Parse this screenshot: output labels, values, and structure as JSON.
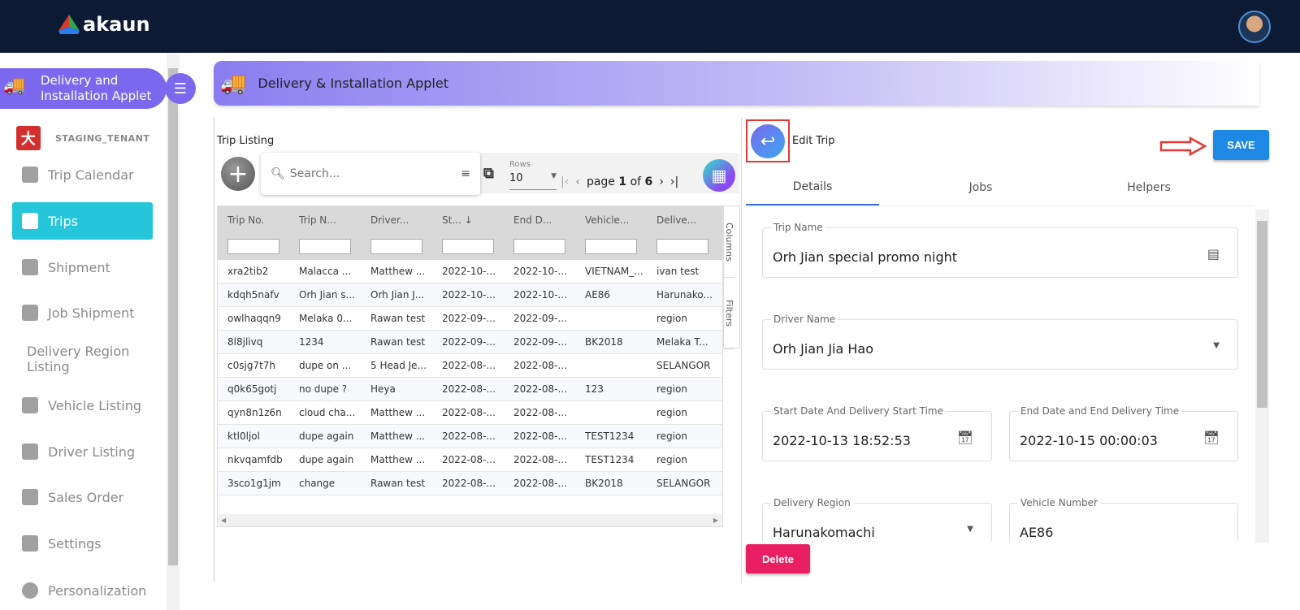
{
  "header": {
    "brand": "akaun"
  },
  "sidebar": {
    "applet_title": "Delivery and Installation Applet",
    "tenant": "STAGING_TENANT",
    "items": [
      {
        "label": "Trip Calendar",
        "icon": "calendar-icon"
      },
      {
        "label": "Trips",
        "icon": "map-icon",
        "active": true
      },
      {
        "label": "Shipment",
        "icon": "ship-icon"
      },
      {
        "label": "Job Shipment",
        "icon": "ship-icon"
      },
      {
        "label": "Delivery Region Listing",
        "icon": ""
      },
      {
        "label": "Vehicle Listing",
        "icon": "truck-icon"
      },
      {
        "label": "Driver Listing",
        "icon": "badge-icon"
      },
      {
        "label": "Sales Order",
        "icon": "ship-icon"
      },
      {
        "label": "Settings",
        "icon": "gear-icon"
      },
      {
        "label": "Personalization",
        "icon": "avatar"
      }
    ]
  },
  "banner": {
    "title": "Delivery & Installation Applet"
  },
  "listing": {
    "title": "Trip Listing",
    "search_placeholder": "Search...",
    "rows_label": "Rows",
    "rows_value": "10",
    "page_prefix": "page",
    "page": "1",
    "of": "of",
    "total_pages": "6",
    "side_tabs": [
      "Columns",
      "Filters"
    ],
    "columns": [
      "Trip No.",
      "Trip N...",
      "Driver...",
      "St...  ↓",
      "End D...",
      "Vehicle...",
      "Delive..."
    ],
    "rows": [
      [
        "xra2tib2",
        "Malacca ...",
        "Matthew ...",
        "2022-10-...",
        "2022-10-...",
        "VIETNAM_...",
        "ivan test"
      ],
      [
        "kdqh5nafv",
        "Orh Jian s...",
        "Orh Jian J...",
        "2022-10-...",
        "2022-10-...",
        "AE86",
        "Harunako..."
      ],
      [
        "owlhaqqn9",
        "Melaka 0...",
        "Rawan test",
        "2022-09-...",
        "2022-09-...",
        "",
        "region"
      ],
      [
        "8l8jlivq",
        "1234",
        "Rawan test",
        "2022-09-...",
        "2022-09-...",
        "BK2018",
        "Melaka T..."
      ],
      [
        "c0sjg7t7h",
        "dupe on ...",
        "5 Head Je...",
        "2022-08-...",
        "2022-08-...",
        "",
        "SELANGOR"
      ],
      [
        "q0k65gotj",
        "no dupe ?",
        "Heya",
        "2022-08-...",
        "2022-08-...",
        "123",
        "region"
      ],
      [
        "qyn8n1z6n",
        "cloud cha...",
        "Matthew ...",
        "2022-08-...",
        "2022-08-...",
        "",
        "region"
      ],
      [
        "ktl0ljol",
        "dupe again",
        "Matthew ...",
        "2022-08-...",
        "2022-08-...",
        "TEST1234",
        "region"
      ],
      [
        "nkvqamfdb",
        "dupe again",
        "Matthew ...",
        "2022-08-...",
        "2022-08-...",
        "TEST1234",
        "region"
      ],
      [
        "3sco1g1jm",
        "change",
        "Rawan test",
        "2022-08-...",
        "2022-08-...",
        "BK2018",
        "SELANGOR"
      ]
    ]
  },
  "edit": {
    "title": "Edit Trip",
    "save_label": "SAVE",
    "delete_label": "Delete",
    "tabs": [
      "Details",
      "Jobs",
      "Helpers"
    ],
    "fields": {
      "trip_name": {
        "label": "Trip Name",
        "value": "Orh Jian special promo night"
      },
      "driver_name": {
        "label": "Driver Name",
        "value": "Orh Jian Jia Hao"
      },
      "start": {
        "label": "Start Date And Delivery Start Time",
        "value": "2022-10-13 18:52:53"
      },
      "end": {
        "label": "End Date and End Delivery Time",
        "value": "2022-10-15 00:00:03"
      },
      "region": {
        "label": "Delivery Region",
        "value": "Harunakomachi"
      },
      "vehicle": {
        "label": "Vehicle Number",
        "value": "AE86"
      }
    }
  },
  "colors": {
    "header": "#0c1b33",
    "accent": "#7b68ee",
    "active": "#26c6da",
    "save": "#1e88e5",
    "delete": "#e91e63"
  }
}
